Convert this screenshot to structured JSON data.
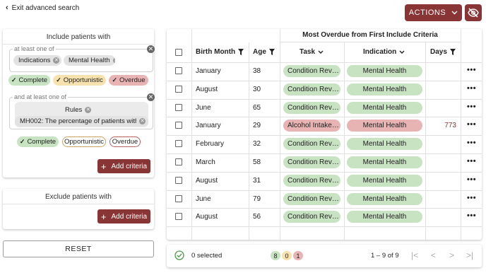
{
  "top": {
    "exit_label": "Exit advanced search",
    "actions_label": "ACTIONS"
  },
  "include": {
    "title": "Include patients with",
    "group1": {
      "legend": "at least one of",
      "chips": [
        "Indications",
        "Mental Health"
      ]
    },
    "group1_statuses": [
      "Complete",
      "Opportunistic",
      "Overdue"
    ],
    "group2": {
      "legend": "and at least one of",
      "rules_label": "Rules",
      "rule_chip": "MH002: The percentage of patients with…"
    },
    "group2_statuses": [
      "Complete",
      "Opportunistic",
      "Overdue"
    ],
    "add_label": "Add criteria"
  },
  "exclude": {
    "title": "Exclude patients with",
    "add_label": "Add criteria"
  },
  "reset_label": "RESET",
  "table": {
    "group_header": "Most Overdue from First Include Criteria",
    "columns": [
      "Birth Month",
      "Age",
      "Task",
      "Indication",
      "Days"
    ],
    "rows": [
      {
        "month": "January",
        "age": "38",
        "task": "Condition Rev…",
        "indication": "Mental Health",
        "days": "",
        "status": "green"
      },
      {
        "month": "August",
        "age": "30",
        "task": "Condition Rev…",
        "indication": "Mental Health",
        "days": "",
        "status": "green"
      },
      {
        "month": "June",
        "age": "65",
        "task": "Condition Rev…",
        "indication": "Mental Health",
        "days": "",
        "status": "green"
      },
      {
        "month": "January",
        "age": "29",
        "task": "Alcohol Intake…",
        "indication": "Mental Health",
        "days": "773",
        "status": "red"
      },
      {
        "month": "February",
        "age": "32",
        "task": "Condition Rev…",
        "indication": "Mental Health",
        "days": "",
        "status": "green"
      },
      {
        "month": "March",
        "age": "58",
        "task": "Condition Rev…",
        "indication": "Mental Health",
        "days": "",
        "status": "green"
      },
      {
        "month": "August",
        "age": "31",
        "task": "Condition Rev…",
        "indication": "Mental Health",
        "days": "",
        "status": "green"
      },
      {
        "month": "June",
        "age": "79",
        "task": "Condition Rev…",
        "indication": "Mental Health",
        "days": "",
        "status": "green"
      },
      {
        "month": "August",
        "age": "56",
        "task": "Condition Rev…",
        "indication": "Mental Health",
        "days": "",
        "status": "green"
      }
    ]
  },
  "footer": {
    "selected_label": "0 selected",
    "counts": {
      "complete": "8",
      "opportunistic": "0",
      "overdue": "1"
    },
    "range_label": "1 – 9 of 9"
  },
  "colors": {
    "brand": "#8a3535",
    "complete": "#c7e3c1",
    "opportunistic": "#f7e2ae",
    "overdue": "#e7b3b3",
    "days_overdue_text": "#8a3535"
  },
  "icons": [
    "chevron-left-icon",
    "chevron-down-icon",
    "eye-off-icon",
    "remove-icon",
    "check-icon",
    "plus-icon",
    "filter-icon",
    "more-icon",
    "check-circle-icon",
    "first-page-icon",
    "prev-page-icon",
    "next-page-icon",
    "last-page-icon"
  ]
}
